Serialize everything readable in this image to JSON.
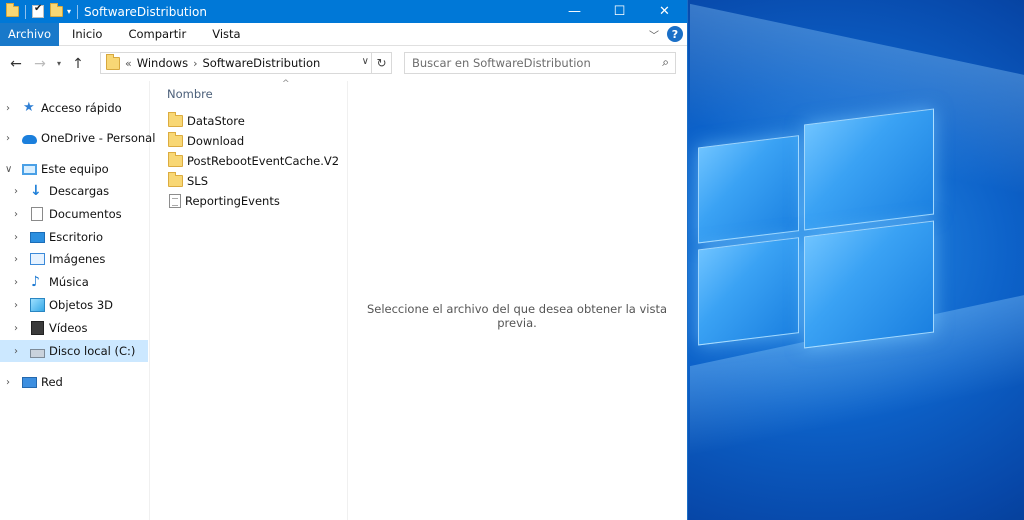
{
  "window": {
    "title": "SoftwareDistribution",
    "controls": {
      "minimize": "—",
      "maximize": "☐",
      "close": "✕"
    }
  },
  "ribbon": {
    "tabs": [
      "Archivo",
      "Inicio",
      "Compartir",
      "Vista"
    ],
    "help": "?"
  },
  "address": {
    "overflow": "«",
    "crumbs": [
      "Windows",
      "SoftwareDistribution"
    ]
  },
  "search": {
    "placeholder": "Buscar en SoftwareDistribution"
  },
  "nav_pane": {
    "items": [
      {
        "label": "Acceso rápido",
        "icon": "star-icon",
        "expanded": false
      },
      {
        "label": "OneDrive - Personal",
        "icon": "cloud-icon",
        "expanded": false
      },
      {
        "label": "Este equipo",
        "icon": "computer-icon",
        "expanded": true
      },
      {
        "label": "Descargas",
        "icon": "download-icon"
      },
      {
        "label": "Documentos",
        "icon": "document-icon"
      },
      {
        "label": "Escritorio",
        "icon": "desktop-icon"
      },
      {
        "label": "Imágenes",
        "icon": "pictures-icon"
      },
      {
        "label": "Música",
        "icon": "music-icon"
      },
      {
        "label": "Objetos 3D",
        "icon": "3d-objects-icon"
      },
      {
        "label": "Vídeos",
        "icon": "videos-icon"
      },
      {
        "label": "Disco local (C:)",
        "icon": "drive-icon",
        "selected": true
      },
      {
        "label": "Red",
        "icon": "network-icon",
        "expanded": false
      }
    ]
  },
  "file_list": {
    "column": "Nombre",
    "items": [
      {
        "name": "DataStore",
        "type": "folder"
      },
      {
        "name": "Download",
        "type": "folder"
      },
      {
        "name": "PostRebootEventCache.V2",
        "type": "folder"
      },
      {
        "name": "SLS",
        "type": "folder"
      },
      {
        "name": "ReportingEvents",
        "type": "file"
      }
    ]
  },
  "preview": {
    "message": "Seleccione el archivo del que desea obtener la vista previa."
  }
}
